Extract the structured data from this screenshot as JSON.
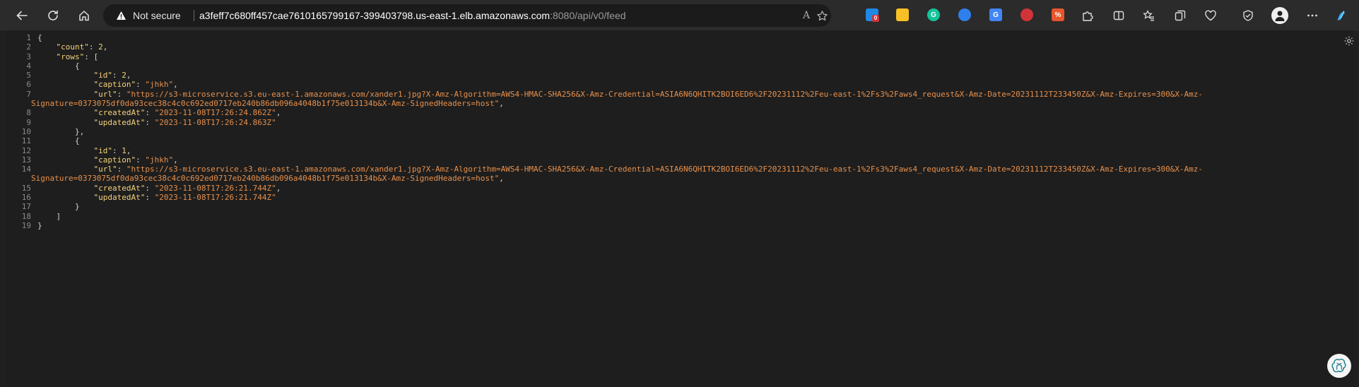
{
  "browser": {
    "address": {
      "security_status": "Not secure",
      "url_host": "a3feff7c680ff457cae7610165799167-399403798.us-east-1.elb.amazonaws.com",
      "url_rest": ":8080/api/v0/feed"
    },
    "read_aloud_label": "A",
    "extensions": [
      {
        "name": "extension-1-icon",
        "badge": "0",
        "color": "#1e88e5"
      },
      {
        "name": "sticky-notes-icon",
        "color": "#f6c026"
      },
      {
        "name": "grammarly-icon",
        "color": "#15c39a"
      },
      {
        "name": "browser-sync-icon",
        "color": "#2f80ed"
      },
      {
        "name": "translate-icon",
        "color": "#4285f4"
      },
      {
        "name": "stop-icon",
        "color": "#d13438"
      },
      {
        "name": "percent-icon",
        "color": "#e8542c"
      }
    ]
  },
  "json_viewer": {
    "lines": [
      {
        "num": "1",
        "html_parts": [
          [
            "p",
            "{"
          ]
        ]
      },
      {
        "num": "2",
        "html_parts": [
          [
            "p",
            "    "
          ],
          [
            "k",
            "\"count\""
          ],
          [
            "p",
            ": "
          ],
          [
            "n",
            "2"
          ],
          [
            "p",
            ","
          ]
        ]
      },
      {
        "num": "3",
        "html_parts": [
          [
            "p",
            "    "
          ],
          [
            "k",
            "\"rows\""
          ],
          [
            "p",
            ": ["
          ]
        ]
      },
      {
        "num": "4",
        "html_parts": [
          [
            "p",
            "        {"
          ]
        ]
      },
      {
        "num": "5",
        "html_parts": [
          [
            "p",
            "            "
          ],
          [
            "k",
            "\"id\""
          ],
          [
            "p",
            ": "
          ],
          [
            "n",
            "2"
          ],
          [
            "p",
            ","
          ]
        ]
      },
      {
        "num": "6",
        "html_parts": [
          [
            "p",
            "            "
          ],
          [
            "k",
            "\"caption\""
          ],
          [
            "p",
            ": "
          ],
          [
            "s",
            "\"jhkh\""
          ],
          [
            "p",
            ","
          ]
        ]
      },
      {
        "num": "7",
        "html_parts": [
          [
            "p",
            "            "
          ],
          [
            "k",
            "\"url\""
          ],
          [
            "p",
            ": "
          ],
          [
            "s",
            "\"https://s3-microservice.s3.eu-east-1.amazonaws.com/xander1.jpg?X-Amz-Algorithm=AWS4-HMAC-SHA256&X-Amz-Credential=ASIA6N6QHITK2BOI6ED6%2F20231112%2Feu-east-1%2Fs3%2Faws4_request&X-Amz-Date=20231112T233450Z&X-Amz-Expires=300&X-Amz-"
          ]
        ],
        "wrap": [
          [
            "s",
            "Signature=0373075df0da93cec38c4c0c692ed0717eb240b86db096a4048b1f75e013134b&X-Amz-SignedHeaders=host\""
          ],
          [
            "p",
            ","
          ]
        ]
      },
      {
        "num": "8",
        "html_parts": [
          [
            "p",
            "            "
          ],
          [
            "k",
            "\"createdAt\""
          ],
          [
            "p",
            ": "
          ],
          [
            "s",
            "\"2023-11-08T17:26:24.862Z\""
          ],
          [
            "p",
            ","
          ]
        ]
      },
      {
        "num": "9",
        "html_parts": [
          [
            "p",
            "            "
          ],
          [
            "k",
            "\"updatedAt\""
          ],
          [
            "p",
            ": "
          ],
          [
            "s",
            "\"2023-11-08T17:26:24.863Z\""
          ]
        ]
      },
      {
        "num": "10",
        "html_parts": [
          [
            "p",
            "        },"
          ]
        ]
      },
      {
        "num": "11",
        "html_parts": [
          [
            "p",
            "        {"
          ]
        ]
      },
      {
        "num": "12",
        "html_parts": [
          [
            "p",
            "            "
          ],
          [
            "k",
            "\"id\""
          ],
          [
            "p",
            ": "
          ],
          [
            "n",
            "1"
          ],
          [
            "p",
            ","
          ]
        ]
      },
      {
        "num": "13",
        "html_parts": [
          [
            "p",
            "            "
          ],
          [
            "k",
            "\"caption\""
          ],
          [
            "p",
            ": "
          ],
          [
            "s",
            "\"jhkh\""
          ],
          [
            "p",
            ","
          ]
        ]
      },
      {
        "num": "14",
        "html_parts": [
          [
            "p",
            "            "
          ],
          [
            "k",
            "\"url\""
          ],
          [
            "p",
            ": "
          ],
          [
            "s",
            "\"https://s3-microservice.s3.eu-east-1.amazonaws.com/xander1.jpg?X-Amz-Algorithm=AWS4-HMAC-SHA256&X-Amz-Credential=ASIA6N6QHITK2BOI6ED6%2F20231112%2Feu-east-1%2Fs3%2Faws4_request&X-Amz-Date=20231112T233450Z&X-Amz-Expires=300&X-Amz-"
          ]
        ],
        "wrap": [
          [
            "s",
            "Signature=0373075df0da93cec38c4c0c692ed0717eb240b86db096a4048b1f75e013134b&X-Amz-SignedHeaders=host\""
          ],
          [
            "p",
            ","
          ]
        ]
      },
      {
        "num": "15",
        "html_parts": [
          [
            "p",
            "            "
          ],
          [
            "k",
            "\"createdAt\""
          ],
          [
            "p",
            ": "
          ],
          [
            "s",
            "\"2023-11-08T17:26:21.744Z\""
          ],
          [
            "p",
            ","
          ]
        ]
      },
      {
        "num": "16",
        "html_parts": [
          [
            "p",
            "            "
          ],
          [
            "k",
            "\"updatedAt\""
          ],
          [
            "p",
            ": "
          ],
          [
            "s",
            "\"2023-11-08T17:26:21.744Z\""
          ]
        ]
      },
      {
        "num": "17",
        "html_parts": [
          [
            "p",
            "        }"
          ]
        ]
      },
      {
        "num": "18",
        "html_parts": [
          [
            "p",
            "    ]"
          ]
        ]
      },
      {
        "num": "19",
        "html_parts": [
          [
            "p",
            "}"
          ]
        ]
      }
    ]
  }
}
